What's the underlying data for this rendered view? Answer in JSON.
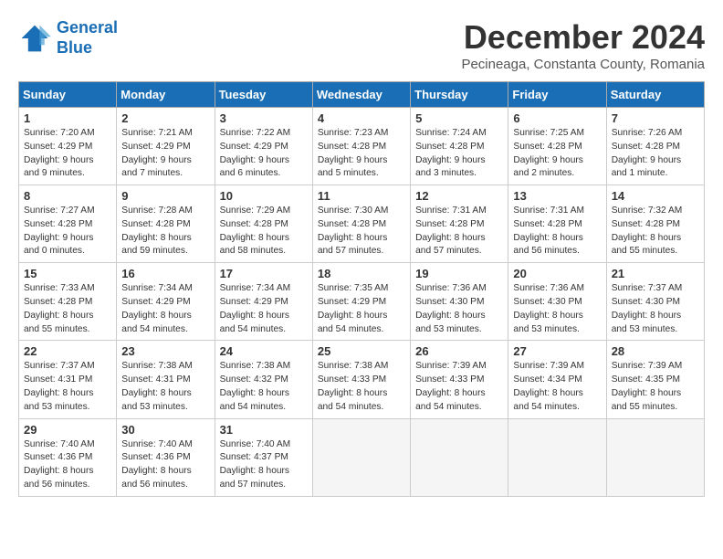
{
  "header": {
    "logo_line1": "General",
    "logo_line2": "Blue",
    "month": "December 2024",
    "location": "Pecineaga, Constanta County, Romania"
  },
  "weekdays": [
    "Sunday",
    "Monday",
    "Tuesday",
    "Wednesday",
    "Thursday",
    "Friday",
    "Saturday"
  ],
  "weeks": [
    [
      {
        "day": 1,
        "info": "Sunrise: 7:20 AM\nSunset: 4:29 PM\nDaylight: 9 hours\nand 9 minutes."
      },
      {
        "day": 2,
        "info": "Sunrise: 7:21 AM\nSunset: 4:29 PM\nDaylight: 9 hours\nand 7 minutes."
      },
      {
        "day": 3,
        "info": "Sunrise: 7:22 AM\nSunset: 4:29 PM\nDaylight: 9 hours\nand 6 minutes."
      },
      {
        "day": 4,
        "info": "Sunrise: 7:23 AM\nSunset: 4:28 PM\nDaylight: 9 hours\nand 5 minutes."
      },
      {
        "day": 5,
        "info": "Sunrise: 7:24 AM\nSunset: 4:28 PM\nDaylight: 9 hours\nand 3 minutes."
      },
      {
        "day": 6,
        "info": "Sunrise: 7:25 AM\nSunset: 4:28 PM\nDaylight: 9 hours\nand 2 minutes."
      },
      {
        "day": 7,
        "info": "Sunrise: 7:26 AM\nSunset: 4:28 PM\nDaylight: 9 hours\nand 1 minute."
      }
    ],
    [
      {
        "day": 8,
        "info": "Sunrise: 7:27 AM\nSunset: 4:28 PM\nDaylight: 9 hours\nand 0 minutes."
      },
      {
        "day": 9,
        "info": "Sunrise: 7:28 AM\nSunset: 4:28 PM\nDaylight: 8 hours\nand 59 minutes."
      },
      {
        "day": 10,
        "info": "Sunrise: 7:29 AM\nSunset: 4:28 PM\nDaylight: 8 hours\nand 58 minutes."
      },
      {
        "day": 11,
        "info": "Sunrise: 7:30 AM\nSunset: 4:28 PM\nDaylight: 8 hours\nand 57 minutes."
      },
      {
        "day": 12,
        "info": "Sunrise: 7:31 AM\nSunset: 4:28 PM\nDaylight: 8 hours\nand 57 minutes."
      },
      {
        "day": 13,
        "info": "Sunrise: 7:31 AM\nSunset: 4:28 PM\nDaylight: 8 hours\nand 56 minutes."
      },
      {
        "day": 14,
        "info": "Sunrise: 7:32 AM\nSunset: 4:28 PM\nDaylight: 8 hours\nand 55 minutes."
      }
    ],
    [
      {
        "day": 15,
        "info": "Sunrise: 7:33 AM\nSunset: 4:28 PM\nDaylight: 8 hours\nand 55 minutes."
      },
      {
        "day": 16,
        "info": "Sunrise: 7:34 AM\nSunset: 4:29 PM\nDaylight: 8 hours\nand 54 minutes."
      },
      {
        "day": 17,
        "info": "Sunrise: 7:34 AM\nSunset: 4:29 PM\nDaylight: 8 hours\nand 54 minutes."
      },
      {
        "day": 18,
        "info": "Sunrise: 7:35 AM\nSunset: 4:29 PM\nDaylight: 8 hours\nand 54 minutes."
      },
      {
        "day": 19,
        "info": "Sunrise: 7:36 AM\nSunset: 4:30 PM\nDaylight: 8 hours\nand 53 minutes."
      },
      {
        "day": 20,
        "info": "Sunrise: 7:36 AM\nSunset: 4:30 PM\nDaylight: 8 hours\nand 53 minutes."
      },
      {
        "day": 21,
        "info": "Sunrise: 7:37 AM\nSunset: 4:30 PM\nDaylight: 8 hours\nand 53 minutes."
      }
    ],
    [
      {
        "day": 22,
        "info": "Sunrise: 7:37 AM\nSunset: 4:31 PM\nDaylight: 8 hours\nand 53 minutes."
      },
      {
        "day": 23,
        "info": "Sunrise: 7:38 AM\nSunset: 4:31 PM\nDaylight: 8 hours\nand 53 minutes."
      },
      {
        "day": 24,
        "info": "Sunrise: 7:38 AM\nSunset: 4:32 PM\nDaylight: 8 hours\nand 54 minutes."
      },
      {
        "day": 25,
        "info": "Sunrise: 7:38 AM\nSunset: 4:33 PM\nDaylight: 8 hours\nand 54 minutes."
      },
      {
        "day": 26,
        "info": "Sunrise: 7:39 AM\nSunset: 4:33 PM\nDaylight: 8 hours\nand 54 minutes."
      },
      {
        "day": 27,
        "info": "Sunrise: 7:39 AM\nSunset: 4:34 PM\nDaylight: 8 hours\nand 54 minutes."
      },
      {
        "day": 28,
        "info": "Sunrise: 7:39 AM\nSunset: 4:35 PM\nDaylight: 8 hours\nand 55 minutes."
      }
    ],
    [
      {
        "day": 29,
        "info": "Sunrise: 7:40 AM\nSunset: 4:36 PM\nDaylight: 8 hours\nand 56 minutes."
      },
      {
        "day": 30,
        "info": "Sunrise: 7:40 AM\nSunset: 4:36 PM\nDaylight: 8 hours\nand 56 minutes."
      },
      {
        "day": 31,
        "info": "Sunrise: 7:40 AM\nSunset: 4:37 PM\nDaylight: 8 hours\nand 57 minutes."
      },
      null,
      null,
      null,
      null
    ]
  ]
}
